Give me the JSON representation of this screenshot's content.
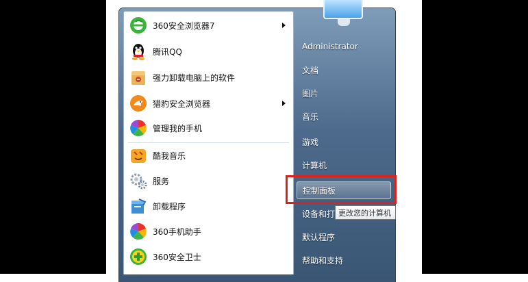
{
  "start_menu": {
    "programs": [
      {
        "label": "360安全浏览器7",
        "icon": "360-browser-icon",
        "has_submenu": true
      },
      {
        "label": "腾讯QQ",
        "icon": "qq-penguin-icon",
        "has_submenu": false
      },
      {
        "label": "强力卸载电脑上的软件",
        "icon": "uninstall-box-icon",
        "has_submenu": false
      },
      {
        "label": "猎豹安全浏览器",
        "icon": "cheetah-browser-icon",
        "has_submenu": true
      },
      {
        "label": "管理我的手机",
        "icon": "phone-manager-icon",
        "has_submenu": false
      },
      {
        "label": "酷我音乐",
        "icon": "kuwo-music-icon",
        "has_submenu": false
      },
      {
        "label": "服务",
        "icon": "services-gears-icon",
        "has_submenu": false
      },
      {
        "label": "卸载程序",
        "icon": "uninstall-program-icon",
        "has_submenu": false
      },
      {
        "label": "360手机助手",
        "icon": "360-phone-assistant-icon",
        "has_submenu": false
      },
      {
        "label": "360安全卫士",
        "icon": "360-security-guard-icon",
        "has_submenu": false
      }
    ],
    "right_items": [
      {
        "label": "Administrator"
      },
      {
        "label": "文档"
      },
      {
        "label": "图片"
      },
      {
        "label": "音乐"
      },
      {
        "label": "游戏"
      },
      {
        "label": "计算机"
      },
      {
        "label": "控制面板"
      },
      {
        "label": "设备和打"
      },
      {
        "label": "默认程序"
      },
      {
        "label": "帮助和支持"
      }
    ],
    "tooltip": "更改您的计算机"
  },
  "colors": {
    "highlight_box": "#e0201b",
    "menu_right_bg": "#4d6a8c"
  }
}
